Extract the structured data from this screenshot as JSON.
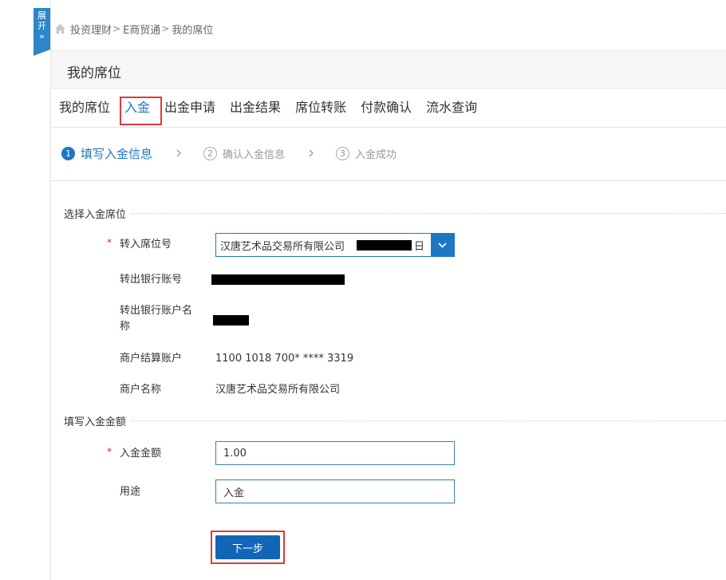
{
  "sidebar_toggle": {
    "label_line1": "展",
    "label_line2": "开",
    "label_line3": "»"
  },
  "breadcrumb": {
    "icon": "home-icon",
    "items": [
      "投资理财",
      "E商贸通",
      "我的席位"
    ],
    "separator": ">"
  },
  "page_title": "我的席位",
  "tabs": [
    {
      "label": "我的席位"
    },
    {
      "label": "入金"
    },
    {
      "label": "出金申请"
    },
    {
      "label": "出金结果"
    },
    {
      "label": "席位转账"
    },
    {
      "label": "付款确认"
    },
    {
      "label": "流水查询"
    }
  ],
  "active_tab": "入金",
  "steps": [
    {
      "num": "1",
      "label": "填写入金信息"
    },
    {
      "num": "2",
      "label": "确认入金信息"
    },
    {
      "num": "3",
      "label": "入金成功"
    }
  ],
  "section1": {
    "title": "选择入金席位",
    "seat_label": "转入席位号",
    "required_mark": "*",
    "seat_select_value": "汉唐艺术品交易所有限公司",
    "seat_select_suffix": "日",
    "bank_account_label": "转出银行账号",
    "bank_account_name_label_line1": "转出银行账户名",
    "bank_account_name_label_line2": "称",
    "merchant_account_label": "商户结算账户",
    "merchant_account_value": "1100 1018 700* **** 3319",
    "merchant_name_label": "商户名称",
    "merchant_name_value": "汉唐艺术品交易所有限公司"
  },
  "section2": {
    "title": "填写入金金额",
    "amount_label": "入金金额",
    "required_mark": "*",
    "amount_value": "1.00",
    "purpose_label": "用途",
    "purpose_value": "入金"
  },
  "next_button_label": "下一步",
  "colors": {
    "accent": "#1f77c4",
    "highlight": "#e0393e",
    "required": "#d9232d"
  }
}
